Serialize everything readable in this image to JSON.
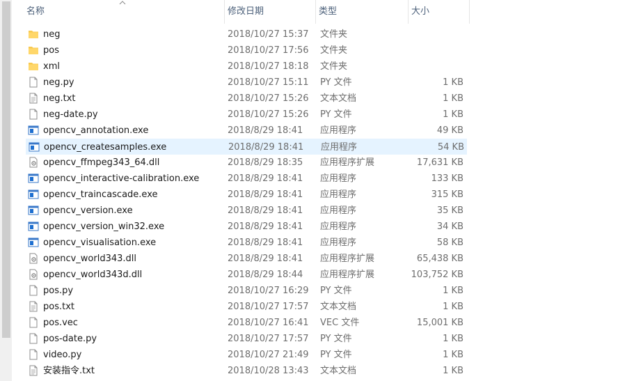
{
  "columns": {
    "name": "名称",
    "date": "修改日期",
    "type": "类型",
    "size": "大小"
  },
  "files": [
    {
      "name": "neg",
      "date": "2018/10/27 15:37",
      "type": "文件夹",
      "size": "",
      "icon": "folder-icon"
    },
    {
      "name": "pos",
      "date": "2018/10/27 17:56",
      "type": "文件夹",
      "size": "",
      "icon": "folder-icon"
    },
    {
      "name": "xml",
      "date": "2018/10/27 18:18",
      "type": "文件夹",
      "size": "",
      "icon": "folder-icon"
    },
    {
      "name": "neg.py",
      "date": "2018/10/27 15:11",
      "type": "PY 文件",
      "size": "1 KB",
      "icon": "file-icon"
    },
    {
      "name": "neg.txt",
      "date": "2018/10/27 15:26",
      "type": "文本文档",
      "size": "1 KB",
      "icon": "text-file-icon"
    },
    {
      "name": "neg-date.py",
      "date": "2018/10/27 15:26",
      "type": "PY 文件",
      "size": "1 KB",
      "icon": "file-icon"
    },
    {
      "name": "opencv_annotation.exe",
      "date": "2018/8/29 18:41",
      "type": "应用程序",
      "size": "49 KB",
      "icon": "exe-icon"
    },
    {
      "name": "opencv_createsamples.exe",
      "date": "2018/8/29 18:41",
      "type": "应用程序",
      "size": "54 KB",
      "icon": "exe-icon",
      "highlighted": true
    },
    {
      "name": "opencv_ffmpeg343_64.dll",
      "date": "2018/8/29 18:35",
      "type": "应用程序扩展",
      "size": "17,631 KB",
      "icon": "dll-icon"
    },
    {
      "name": "opencv_interactive-calibration.exe",
      "date": "2018/8/29 18:41",
      "type": "应用程序",
      "size": "133 KB",
      "icon": "exe-icon"
    },
    {
      "name": "opencv_traincascade.exe",
      "date": "2018/8/29 18:41",
      "type": "应用程序",
      "size": "315 KB",
      "icon": "exe-icon"
    },
    {
      "name": "opencv_version.exe",
      "date": "2018/8/29 18:41",
      "type": "应用程序",
      "size": "35 KB",
      "icon": "exe-icon"
    },
    {
      "name": "opencv_version_win32.exe",
      "date": "2018/8/29 18:41",
      "type": "应用程序",
      "size": "34 KB",
      "icon": "exe-icon"
    },
    {
      "name": "opencv_visualisation.exe",
      "date": "2018/8/29 18:41",
      "type": "应用程序",
      "size": "58 KB",
      "icon": "exe-icon"
    },
    {
      "name": "opencv_world343.dll",
      "date": "2018/8/29 18:41",
      "type": "应用程序扩展",
      "size": "65,438 KB",
      "icon": "dll-icon"
    },
    {
      "name": "opencv_world343d.dll",
      "date": "2018/8/29 18:44",
      "type": "应用程序扩展",
      "size": "103,752 KB",
      "icon": "dll-icon"
    },
    {
      "name": "pos.py",
      "date": "2018/10/27 16:29",
      "type": "PY 文件",
      "size": "1 KB",
      "icon": "file-icon"
    },
    {
      "name": "pos.txt",
      "date": "2018/10/27 17:57",
      "type": "文本文档",
      "size": "1 KB",
      "icon": "text-file-icon"
    },
    {
      "name": "pos.vec",
      "date": "2018/10/27 16:41",
      "type": "VEC 文件",
      "size": "15,001 KB",
      "icon": "file-icon"
    },
    {
      "name": "pos-date.py",
      "date": "2018/10/27 17:57",
      "type": "PY 文件",
      "size": "1 KB",
      "icon": "file-icon"
    },
    {
      "name": "video.py",
      "date": "2018/10/27 21:49",
      "type": "PY 文件",
      "size": "1 KB",
      "icon": "file-icon"
    },
    {
      "name": "安装指令.txt",
      "date": "2018/10/28 13:43",
      "type": "文本文档",
      "size": "1 KB",
      "icon": "text-file-icon"
    }
  ],
  "colors": {
    "highlight": "#e5f3ff",
    "header_text": "#4c607a",
    "secondary_text": "#6d6d6d",
    "folder": "#f8c94f",
    "exe_blue": "#1e6fd0"
  }
}
